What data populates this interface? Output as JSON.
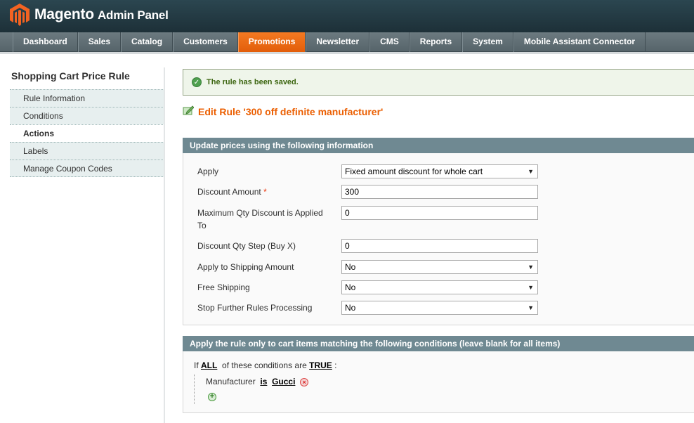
{
  "header": {
    "brand": "Magento",
    "subtitle": "Admin Panel",
    "logo_icon": "magento-logo-icon"
  },
  "nav": [
    {
      "label": "Dashboard",
      "active": false
    },
    {
      "label": "Sales",
      "active": false
    },
    {
      "label": "Catalog",
      "active": false
    },
    {
      "label": "Customers",
      "active": false
    },
    {
      "label": "Promotions",
      "active": true
    },
    {
      "label": "Newsletter",
      "active": false
    },
    {
      "label": "CMS",
      "active": false
    },
    {
      "label": "Reports",
      "active": false
    },
    {
      "label": "System",
      "active": false
    },
    {
      "label": "Mobile Assistant Connector",
      "active": false
    }
  ],
  "sidebar": {
    "title": "Shopping Cart Price Rule",
    "items": [
      {
        "label": "Rule Information",
        "active": false
      },
      {
        "label": "Conditions",
        "active": false
      },
      {
        "label": "Actions",
        "active": true
      },
      {
        "label": "Labels",
        "active": false
      },
      {
        "label": "Manage Coupon Codes",
        "active": false
      }
    ]
  },
  "message": {
    "text": "The rule has been saved.",
    "icon": "success-check-icon"
  },
  "page": {
    "title": "Edit Rule '300 off definite manufacturer'",
    "icon": "edit-rule-icon"
  },
  "actions_box": {
    "header": "Update prices using the following information",
    "fields": {
      "apply": {
        "label": "Apply",
        "value": "Fixed amount discount for whole cart"
      },
      "discount_amount": {
        "label": "Discount Amount",
        "required": "*",
        "value": "300"
      },
      "max_qty": {
        "label_line1": "Maximum Qty Discount is Applied",
        "label_line2": "To",
        "value": "0"
      },
      "qty_step": {
        "label": "Discount Qty Step (Buy X)",
        "value": "0"
      },
      "apply_shipping": {
        "label": "Apply to Shipping Amount",
        "value": "No"
      },
      "free_shipping": {
        "label": "Free Shipping",
        "value": "No"
      },
      "stop_rules": {
        "label": "Stop Further Rules Processing",
        "value": "No"
      }
    }
  },
  "conditions_box": {
    "header": "Apply the rule only to cart items matching the following conditions (leave blank for all items)",
    "if_text": "If",
    "aggregator": "ALL",
    "middle_text": "of these conditions are",
    "value": "TRUE",
    "colon": ":",
    "condition": {
      "attribute": "Manufacturer",
      "operator": "is",
      "value": "Gucci"
    }
  },
  "colors": {
    "accent": "#eb5e00",
    "header_bg": "#2b4650",
    "nav_bg": "#6c7a80",
    "box_header": "#6f8992",
    "success_text": "#3d6611"
  }
}
